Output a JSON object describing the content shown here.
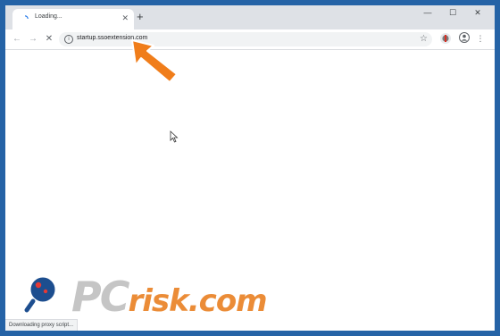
{
  "browser": {
    "tab": {
      "title": "Loading...",
      "close_glyph": "✕"
    },
    "new_tab_glyph": "+",
    "window_controls": {
      "minimize": "—",
      "maximize": "☐",
      "close": "✕"
    },
    "nav": {
      "back": "←",
      "forward": "→",
      "stop": "✕"
    },
    "address_bar": {
      "url": "startup.ssoextension.com",
      "info_glyph": "i",
      "bookmark_glyph": "☆"
    },
    "menu_glyph": "⋮"
  },
  "status_bar": {
    "text": "Downloading proxy script..."
  },
  "watermark": {
    "text_pc": "PC",
    "text_risk": "risk.com"
  },
  "colors": {
    "frame": "#2563a6",
    "arrow": "#f07d1a",
    "tab_strip": "#dee1e6",
    "omnibox": "#f1f3f4"
  },
  "icons": [
    "loading-spinner-icon",
    "info-icon",
    "star-icon",
    "extension-icon",
    "profile-icon",
    "menu-icon",
    "orange-arrow-icon",
    "mouse-cursor-icon",
    "magnifier-logo-icon"
  ]
}
